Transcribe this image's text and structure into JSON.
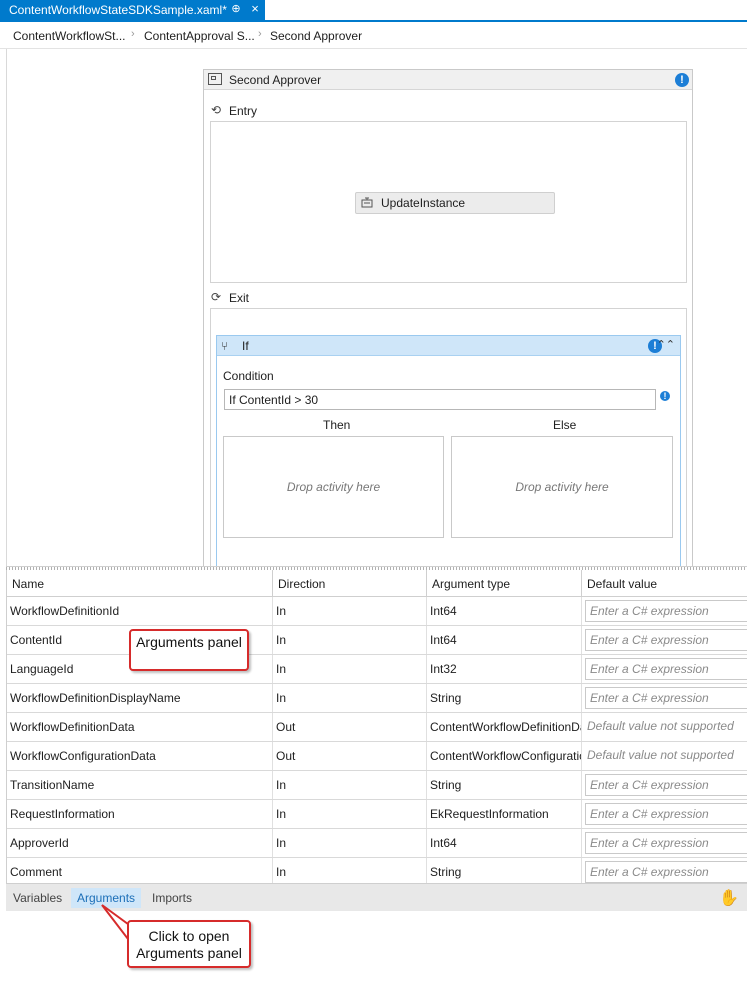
{
  "tab": {
    "title": "ContentWorkflowStateSDKSample.xaml*",
    "pin_glyph": "⊕",
    "close_glyph": "×"
  },
  "breadcrumb": [
    "ContentWorkflowSt...",
    "ContentApproval S...",
    "Second Approver"
  ],
  "state": {
    "title": "Second Approver",
    "entry_label": "Entry",
    "exit_label": "Exit",
    "entry_activity": "UpdateInstance",
    "if_activity": {
      "title": "If",
      "condition_label": "Condition",
      "condition_value": "If ContentId > 30",
      "then_label": "Then",
      "else_label": "Else",
      "drop_hint": "Drop activity here"
    }
  },
  "arguments": {
    "columns": [
      "Name",
      "Direction",
      "Argument type",
      "Default value"
    ],
    "rows": [
      {
        "name": "WorkflowDefinitionId",
        "direction": "In",
        "type": "Int64",
        "default": "Enter a C# expression"
      },
      {
        "name": "ContentId",
        "direction": "In",
        "type": "Int64",
        "default": "Enter a C# expression"
      },
      {
        "name": "LanguageId",
        "direction": "In",
        "type": "Int32",
        "default": "Enter a C# expression"
      },
      {
        "name": "WorkflowDefinitionDisplayName",
        "direction": "In",
        "type": "String",
        "default": "Enter a C# expression"
      },
      {
        "name": "WorkflowDefinitionData",
        "direction": "Out",
        "type": "ContentWorkflowDefinitionData",
        "default": "Default value not supported"
      },
      {
        "name": "WorkflowConfigurationData",
        "direction": "Out",
        "type": "ContentWorkflowConfigurationData",
        "default": "Default value not supported"
      },
      {
        "name": "TransitionName",
        "direction": "In",
        "type": "String",
        "default": "Enter a C# expression"
      },
      {
        "name": "RequestInformation",
        "direction": "In",
        "type": "EkRequestInformation",
        "default": "Enter a C# expression"
      },
      {
        "name": "ApproverId",
        "direction": "In",
        "type": "Int64",
        "default": "Enter a C# expression"
      },
      {
        "name": "Comment",
        "direction": "In",
        "type": "String",
        "default": "Enter a C# expression"
      }
    ]
  },
  "bottom_tabs": [
    {
      "label": "Variables",
      "active": false
    },
    {
      "label": "Arguments",
      "active": true
    },
    {
      "label": "Imports",
      "active": false
    }
  ],
  "callouts": {
    "arguments_panel": "Arguments panel",
    "open_panel": "Click to open Arguments panel"
  },
  "colors": {
    "accent": "#007acc",
    "active_tab_bg": "#cfe6f9",
    "callout_border": "#d62b2b",
    "warning": "#1c7ed6"
  },
  "icons": {
    "warning": "!",
    "collapse": "⌃⌃",
    "entry": "⟲",
    "exit": "⟳",
    "hand": "✋"
  }
}
